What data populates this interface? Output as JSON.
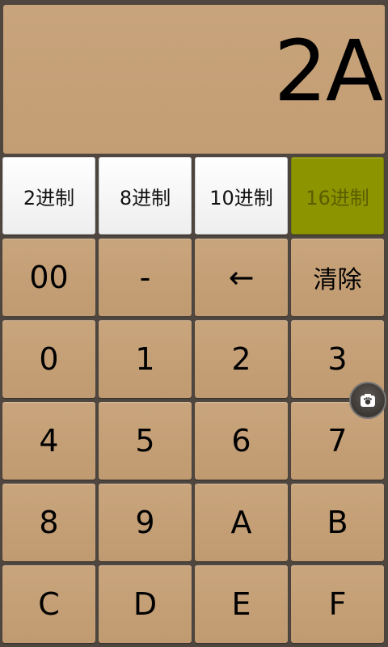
{
  "display": {
    "value": "2A"
  },
  "bases": [
    {
      "label": "2进制",
      "active": false
    },
    {
      "label": "8进制",
      "active": false
    },
    {
      "label": "10进制",
      "active": false
    },
    {
      "label": "16进制",
      "active": true
    }
  ],
  "keys": {
    "row1": [
      "00",
      "-",
      "←",
      "清除"
    ],
    "row2": [
      "0",
      "1",
      "2",
      "3"
    ],
    "row3": [
      "4",
      "5",
      "6",
      "7"
    ],
    "row4": [
      "8",
      "9",
      "A",
      "B"
    ],
    "row5": [
      "C",
      "D",
      "E",
      "F"
    ]
  },
  "colors": {
    "key_bg": "#c4a075",
    "active_base_bg": "#8c9400",
    "base_bg": "#ffffff"
  },
  "floating_icon": "camera-paw-icon"
}
